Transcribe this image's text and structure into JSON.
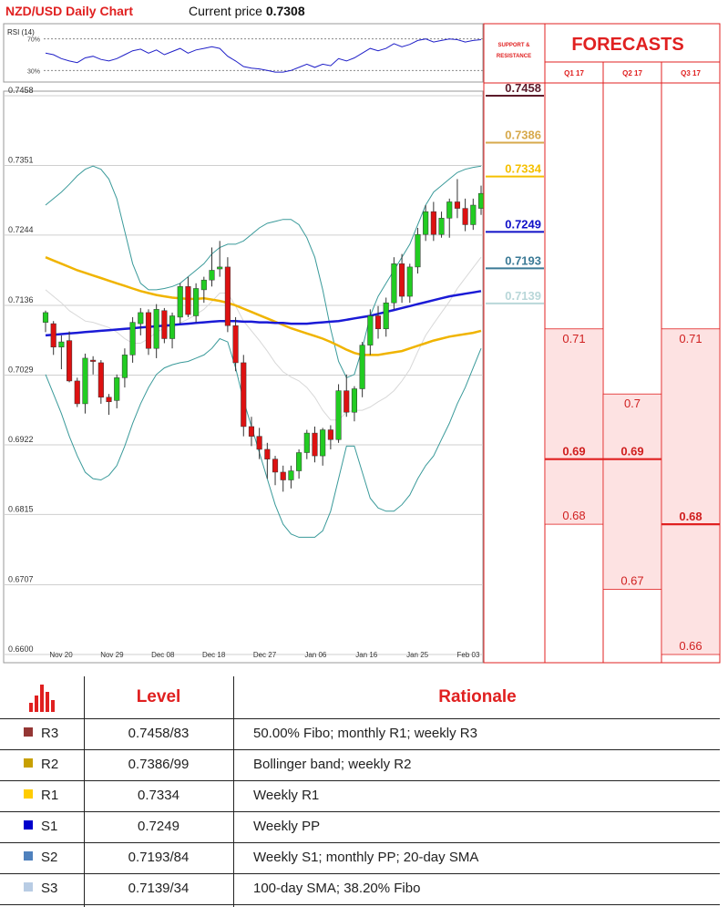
{
  "header": {
    "title": "NZD/USD Daily Chart",
    "price_label": "Current price",
    "price_value": "0.7308"
  },
  "forecasts_panel": {
    "support_resistance_label": [
      "SUPPORT &",
      "RESISTANCE"
    ],
    "title": "FORECASTS",
    "quarters": [
      "Q1 17",
      "Q2 17",
      "Q3 17"
    ],
    "levels": [
      {
        "value": "0.7458",
        "color": "#5b1a2a"
      },
      {
        "value": "0.7386",
        "color": "#d7a94b"
      },
      {
        "value": "0.7334",
        "color": "#f5c000"
      },
      {
        "value": "0.7249",
        "color": "#1010c8"
      },
      {
        "value": "0.7193",
        "color": "#3b7a96"
      },
      {
        "value": "0.7139",
        "color": "#b9d7d9"
      }
    ],
    "forecast_columns": [
      {
        "quarter": "Q1 17",
        "high": "0.71",
        "mid": "0.69",
        "low": "0.68"
      },
      {
        "quarter": "Q2 17",
        "high": "0.7",
        "mid": "0.69",
        "low": "0.67"
      },
      {
        "quarter": "Q3 17",
        "high": "0.71",
        "mid": "0.68",
        "low": "0.66"
      }
    ],
    "colors": {
      "accent": "#e02020",
      "band_fill": "#fde2e2"
    }
  },
  "chart_data": {
    "type": "candlestick",
    "instrument": "NZD/USD",
    "ylim": [
      0.66,
      0.7458
    ],
    "yticks": [
      "0.7458",
      "0.7351",
      "0.7244",
      "0.7136",
      "0.7029",
      "0.6922",
      "0.6815",
      "0.6707",
      "0.6600"
    ],
    "xticks": [
      "Nov 20",
      "Nov 29",
      "Dec 08",
      "Dec 18",
      "Dec 27",
      "Jan 06",
      "Jan 16",
      "Jan 25",
      "Feb 03"
    ],
    "candles": [
      [
        0.711,
        0.7128,
        0.7095,
        0.7125
      ],
      [
        0.7108,
        0.7112,
        0.706,
        0.7072
      ],
      [
        0.7072,
        0.709,
        0.7038,
        0.708
      ],
      [
        0.7082,
        0.7096,
        0.7018,
        0.702
      ],
      [
        0.702,
        0.7025,
        0.698,
        0.6985
      ],
      [
        0.6985,
        0.7062,
        0.697,
        0.7055
      ],
      [
        0.7052,
        0.7058,
        0.703,
        0.705
      ],
      [
        0.7048,
        0.7052,
        0.6985,
        0.6995
      ],
      [
        0.6995,
        0.7,
        0.6968,
        0.6988
      ],
      [
        0.699,
        0.703,
        0.6978,
        0.7025
      ],
      [
        0.7025,
        0.707,
        0.701,
        0.706
      ],
      [
        0.706,
        0.7118,
        0.7048,
        0.711
      ],
      [
        0.7108,
        0.7132,
        0.709,
        0.7125
      ],
      [
        0.7125,
        0.713,
        0.706,
        0.707
      ],
      [
        0.707,
        0.7138,
        0.7055,
        0.713
      ],
      [
        0.7128,
        0.7132,
        0.7078,
        0.7085
      ],
      [
        0.7085,
        0.7125,
        0.707,
        0.712
      ],
      [
        0.7118,
        0.717,
        0.7108,
        0.7165
      ],
      [
        0.7165,
        0.718,
        0.7118,
        0.7122
      ],
      [
        0.712,
        0.717,
        0.711,
        0.7162
      ],
      [
        0.716,
        0.718,
        0.714,
        0.7175
      ],
      [
        0.7175,
        0.7225,
        0.7165,
        0.719
      ],
      [
        0.7192,
        0.7235,
        0.718,
        0.7195
      ],
      [
        0.7195,
        0.721,
        0.7095,
        0.7105
      ],
      [
        0.7105,
        0.7118,
        0.7035,
        0.7048
      ],
      [
        0.7048,
        0.706,
        0.6935,
        0.695
      ],
      [
        0.695,
        0.6965,
        0.692,
        0.6935
      ],
      [
        0.6935,
        0.6948,
        0.69,
        0.6915
      ],
      [
        0.6915,
        0.6925,
        0.687,
        0.69
      ],
      [
        0.69,
        0.6905,
        0.686,
        0.688
      ],
      [
        0.688,
        0.689,
        0.685,
        0.6868
      ],
      [
        0.6868,
        0.689,
        0.6855,
        0.6882
      ],
      [
        0.6882,
        0.6915,
        0.687,
        0.691
      ],
      [
        0.691,
        0.6945,
        0.69,
        0.694
      ],
      [
        0.694,
        0.695,
        0.6895,
        0.6905
      ],
      [
        0.6905,
        0.6948,
        0.689,
        0.6945
      ],
      [
        0.6945,
        0.6952,
        0.6915,
        0.693
      ],
      [
        0.693,
        0.7015,
        0.6925,
        0.7005
      ],
      [
        0.7005,
        0.703,
        0.6965,
        0.6972
      ],
      [
        0.6972,
        0.7012,
        0.6958,
        0.7008
      ],
      [
        0.7008,
        0.708,
        0.6995,
        0.7075
      ],
      [
        0.7075,
        0.713,
        0.706,
        0.712
      ],
      [
        0.712,
        0.7135,
        0.7085,
        0.71
      ],
      [
        0.71,
        0.7148,
        0.7088,
        0.714
      ],
      [
        0.714,
        0.721,
        0.713,
        0.72
      ],
      [
        0.72,
        0.7215,
        0.714,
        0.715
      ],
      [
        0.715,
        0.72,
        0.714,
        0.7195
      ],
      [
        0.7195,
        0.7255,
        0.7185,
        0.7245
      ],
      [
        0.7245,
        0.729,
        0.7235,
        0.728
      ],
      [
        0.728,
        0.7295,
        0.7235,
        0.7245
      ],
      [
        0.7245,
        0.728,
        0.724,
        0.727
      ],
      [
        0.727,
        0.73,
        0.724,
        0.7295
      ],
      [
        0.7295,
        0.733,
        0.727,
        0.7285
      ],
      [
        0.7285,
        0.73,
        0.725,
        0.726
      ],
      [
        0.726,
        0.73,
        0.7252,
        0.729
      ],
      [
        0.7285,
        0.732,
        0.7275,
        0.7308
      ]
    ],
    "rsi": {
      "label": "RSI (14)",
      "levels": [
        "70%",
        "30%"
      ],
      "values": [
        52,
        50,
        45,
        42,
        40,
        46,
        48,
        44,
        42,
        45,
        50,
        55,
        57,
        52,
        56,
        50,
        54,
        58,
        52,
        56,
        58,
        60,
        58,
        48,
        42,
        35,
        33,
        32,
        30,
        28,
        28,
        30,
        34,
        38,
        34,
        38,
        36,
        45,
        42,
        46,
        52,
        58,
        55,
        58,
        64,
        60,
        63,
        68,
        70,
        66,
        68,
        70,
        69,
        66,
        68,
        69
      ]
    },
    "sma100": [
      0.721,
      0.7205,
      0.72,
      0.7195,
      0.719,
      0.7186,
      0.7182,
      0.7178,
      0.7174,
      0.717,
      0.7166,
      0.7162,
      0.7158,
      0.7155,
      0.7152,
      0.715,
      0.7148,
      0.7147,
      0.7146,
      0.7146,
      0.7147,
      0.7145,
      0.7143,
      0.714,
      0.7136,
      0.7131,
      0.7126,
      0.7121,
      0.7116,
      0.7111,
      0.7106,
      0.7101,
      0.7097,
      0.7093,
      0.7089,
      0.7085,
      0.708,
      0.7074,
      0.7068,
      0.7063,
      0.706,
      0.706,
      0.706,
      0.7062,
      0.7064,
      0.7066,
      0.707,
      0.7074,
      0.7078,
      0.7082,
      0.7085,
      0.7088,
      0.709,
      0.7092,
      0.7094,
      0.7097
    ],
    "sma200": [
      0.709,
      0.7091,
      0.7092,
      0.7093,
      0.7094,
      0.7095,
      0.7096,
      0.7097,
      0.7098,
      0.7099,
      0.71,
      0.7101,
      0.7102,
      0.7103,
      0.7104,
      0.7105,
      0.7106,
      0.7107,
      0.7108,
      0.7109,
      0.711,
      0.7111,
      0.7112,
      0.7112,
      0.7112,
      0.7111,
      0.7111,
      0.711,
      0.711,
      0.7109,
      0.7109,
      0.7108,
      0.7108,
      0.7108,
      0.7109,
      0.711,
      0.7111,
      0.7112,
      0.7114,
      0.7116,
      0.7118,
      0.712,
      0.7123,
      0.7126,
      0.7129,
      0.7132,
      0.7135,
      0.7138,
      0.7141,
      0.7144,
      0.7147,
      0.715,
      0.7152,
      0.7154,
      0.7156,
      0.7158
    ],
    "bb_upper": [
      0.729,
      0.73,
      0.731,
      0.7322,
      0.7335,
      0.7345,
      0.735,
      0.7345,
      0.733,
      0.73,
      0.725,
      0.72,
      0.717,
      0.716,
      0.716,
      0.7162,
      0.7165,
      0.717,
      0.718,
      0.719,
      0.72,
      0.7215,
      0.7225,
      0.723,
      0.723,
      0.7235,
      0.7245,
      0.7255,
      0.7262,
      0.7265,
      0.7268,
      0.7268,
      0.726,
      0.724,
      0.721,
      0.716,
      0.71,
      0.705,
      0.7025,
      0.703,
      0.707,
      0.712,
      0.715,
      0.717,
      0.719,
      0.721,
      0.723,
      0.726,
      0.729,
      0.731,
      0.732,
      0.733,
      0.734,
      0.7345,
      0.7348,
      0.735
    ],
    "bb_lower": [
      0.703,
      0.7,
      0.697,
      0.6935,
      0.6905,
      0.688,
      0.687,
      0.6868,
      0.6875,
      0.689,
      0.692,
      0.6955,
      0.6985,
      0.701,
      0.703,
      0.704,
      0.7045,
      0.7048,
      0.705,
      0.7055,
      0.706,
      0.707,
      0.7085,
      0.708,
      0.704,
      0.699,
      0.695,
      0.691,
      0.687,
      0.683,
      0.68,
      0.6785,
      0.678,
      0.678,
      0.678,
      0.679,
      0.682,
      0.687,
      0.692,
      0.692,
      0.688,
      0.684,
      0.6825,
      0.682,
      0.682,
      0.683,
      0.6845,
      0.687,
      0.689,
      0.6905,
      0.693,
      0.6955,
      0.6985,
      0.701,
      0.704,
      0.707
    ],
    "bb_mid": [
      0.716,
      0.715,
      0.714,
      0.7128,
      0.712,
      0.7112,
      0.711,
      0.7106,
      0.7102,
      0.7095,
      0.7085,
      0.7078,
      0.7078,
      0.7085,
      0.7095,
      0.7101,
      0.7105,
      0.7109,
      0.7115,
      0.7122,
      0.713,
      0.7142,
      0.7155,
      0.7155,
      0.7135,
      0.7112,
      0.7097,
      0.7082,
      0.7066,
      0.7048,
      0.7034,
      0.7026,
      0.702,
      0.701,
      0.6995,
      0.6975,
      0.696,
      0.696,
      0.6972,
      0.6975,
      0.6975,
      0.698,
      0.6988,
      0.6995,
      0.7005,
      0.702,
      0.7038,
      0.7065,
      0.709,
      0.7108,
      0.7125,
      0.7142,
      0.7162,
      0.7178,
      0.7194,
      0.721
    ]
  },
  "levels_table": {
    "headers": {
      "level": "Level",
      "rationale": "Rationale"
    },
    "rows": [
      {
        "name": "R3",
        "level": "0.7458/83",
        "rationale": "50.00% Fibo; monthly R1; weekly R3",
        "color": "#943634"
      },
      {
        "name": "R2",
        "level": "0.7386/99",
        "rationale": "Bollinger band; weekly R2",
        "color": "#c8a000"
      },
      {
        "name": "R1",
        "level": "0.7334",
        "rationale": "Weekly R1",
        "color": "#ffcc00"
      },
      {
        "name": "S1",
        "level": "0.7249",
        "rationale": "Weekly PP",
        "color": "#0000cc"
      },
      {
        "name": "S2",
        "level": "0.7193/84",
        "rationale": "Weekly S1; monthly PP; 20-day SMA",
        "color": "#4f81bd"
      },
      {
        "name": "S3",
        "level": "0.7139/34",
        "rationale": "100-day SMA; 38.20% Fibo",
        "color": "#b8cce4"
      }
    ]
  }
}
